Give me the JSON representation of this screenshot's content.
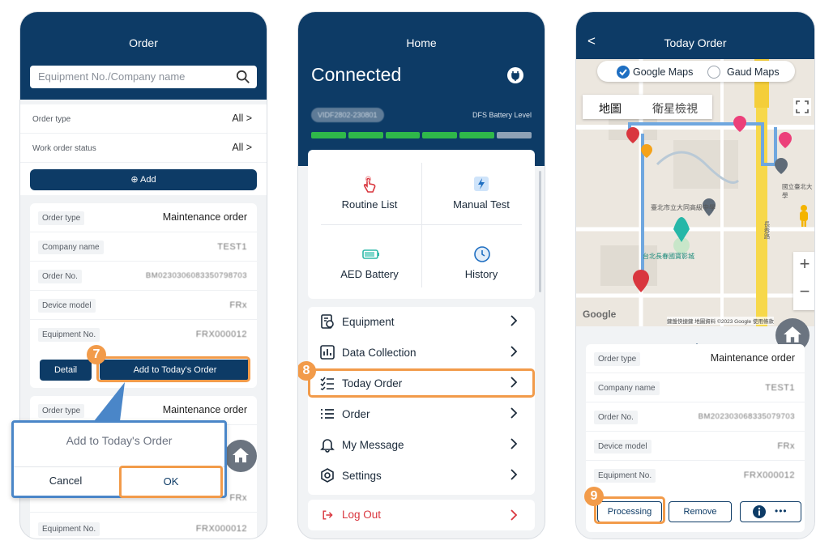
{
  "order_screen": {
    "title": "Order",
    "search_placeholder": "Equipment No./Company name",
    "filters": [
      {
        "label": "Order type",
        "value": "All >"
      },
      {
        "label": "Work order status",
        "value": "All >"
      }
    ],
    "add_label": "Add",
    "card1": {
      "rows": [
        {
          "label": "Order type",
          "value": "Maintenance order"
        },
        {
          "label": "Company name",
          "value": "TEST1"
        },
        {
          "label": "Order No.",
          "value": "BM0230306083350798703"
        },
        {
          "label": "Device model",
          "value": "FRx"
        },
        {
          "label": "Equipment No.",
          "value": "FRX000012"
        }
      ],
      "detail_label": "Detail",
      "add_today_label": "Add to Today's Order"
    },
    "card2": {
      "order_type_label": "Order type",
      "order_type_value": "Maintenance order",
      "device_model_value": "FRx",
      "equipment_label": "Equipment No.",
      "equipment_value": "FRX000012"
    },
    "dialog": {
      "title": "Add to Today's Order",
      "cancel_label": "Cancel",
      "ok_label": "OK"
    },
    "step_badge": "7"
  },
  "home_screen": {
    "title": "Home",
    "status": "Connected",
    "device_id": "VIDF2802-230801",
    "battery_label": "DFS Battery Level",
    "battery_level_fraction": 0.8,
    "grid": [
      {
        "label": "Routine List",
        "icon": "touch-icon"
      },
      {
        "label": "Manual Test",
        "icon": "bolt-icon"
      },
      {
        "label": "AED Battery",
        "icon": "battery-icon"
      },
      {
        "label": "History",
        "icon": "clock-icon"
      }
    ],
    "menu": [
      {
        "label": "Equipment",
        "icon": "equipment-icon"
      },
      {
        "label": "Data Collection",
        "icon": "chart-icon"
      },
      {
        "label": "Today Order",
        "icon": "checklist-icon"
      },
      {
        "label": "Order",
        "icon": "list-icon"
      },
      {
        "label": "My Message",
        "icon": "bell-icon"
      },
      {
        "label": "Settings",
        "icon": "gear-icon"
      }
    ],
    "logout_label": "Log Out",
    "step_badge": "8"
  },
  "today_screen": {
    "title": "Today Order",
    "back_glyph": "<",
    "map_options": [
      "Google Maps",
      "Gaud Maps"
    ],
    "map_tabs": [
      "地圖",
      "衛星檢視"
    ],
    "map_labels": {
      "street1": "臺北市立大同高級中學",
      "park": "台北長春國寶影城",
      "attribution": "鍵盤快捷鍵  地圖資料 ©2023 Google  使用條款",
      "google": "Google",
      "school": "國立臺北大學",
      "hospital": "長春路"
    },
    "rows": [
      {
        "label": "Order type",
        "value": "Maintenance order"
      },
      {
        "label": "Company name",
        "value": "TEST1"
      },
      {
        "label": "Order No.",
        "value": "BM202303068335079703"
      },
      {
        "label": "Device model",
        "value": "FRx"
      },
      {
        "label": "Equipment No.",
        "value": "FRX000012"
      }
    ],
    "processing_label": "Processing",
    "remove_label": "Remove",
    "more_glyph": "•••",
    "step_badge": "9"
  },
  "colors": {
    "navy": "#0d3b66",
    "orange": "#f29b4a",
    "battery_green": "#2fb84a",
    "logout_red": "#d9363e"
  }
}
